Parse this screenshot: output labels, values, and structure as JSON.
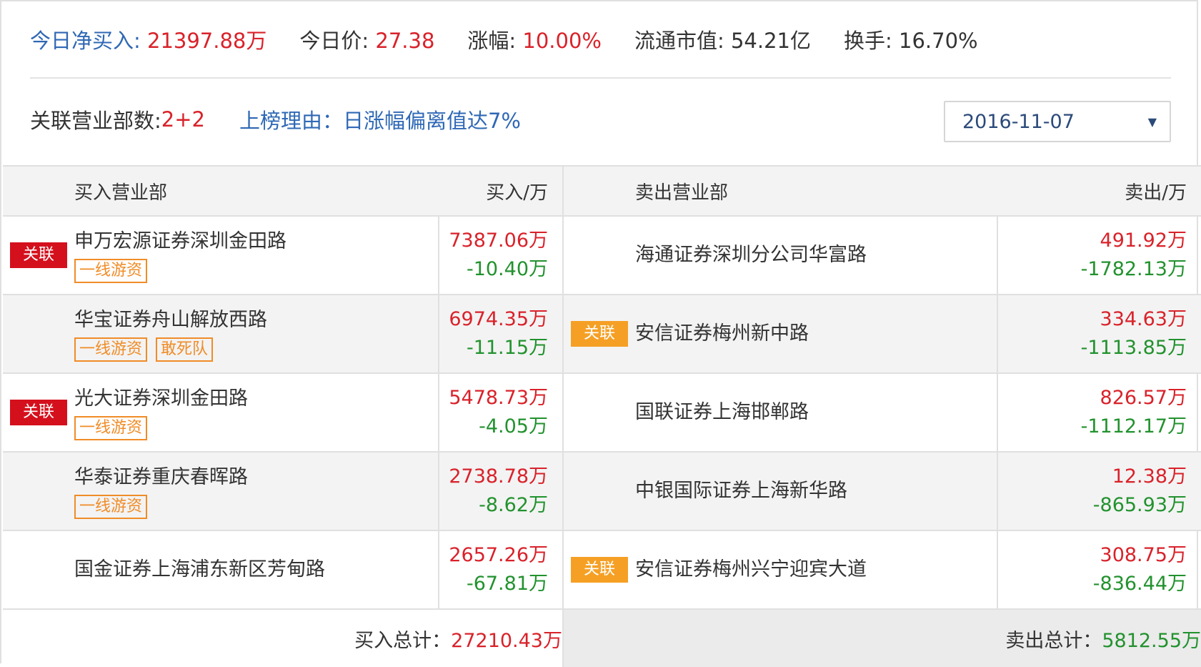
{
  "summary": {
    "net_buy_label": "今日净买入:",
    "net_buy_value": "21397.88万",
    "price_label": "今日价:",
    "price_value": "27.38",
    "change_label": "涨幅:",
    "change_value": "10.00%",
    "market_cap_label": "流通市值:",
    "market_cap_value": "54.21亿",
    "turnover_label": "换手:",
    "turnover_value": "16.70%"
  },
  "info": {
    "related_label": "关联营业部数:",
    "related_value": "2+2",
    "reason": "上榜理由：日涨幅偏离值达7%",
    "date": "2016-11-07",
    "dropdown_icon": "caret-down-icon"
  },
  "table": {
    "headers": {
      "buy_dept": "买入营业部",
      "buy_amount": "买入/万",
      "sell_dept": "卖出营业部",
      "sell_amount": "卖出/万"
    },
    "rows": [
      {
        "buy_badge": "关联",
        "buy_name": "申万宏源证券深圳金田路",
        "buy_tags": [
          "一线游资"
        ],
        "buy_amount": "7387.06万",
        "buy_sell_amount": "-10.40万",
        "sell_badge": "",
        "sell_name": "海通证券深圳分公司华富路",
        "sell_buy_amount": "491.92万",
        "sell_amount": "-1782.13万"
      },
      {
        "buy_badge": "",
        "buy_name": "华宝证券舟山解放西路",
        "buy_tags": [
          "一线游资",
          "敢死队"
        ],
        "buy_amount": "6974.35万",
        "buy_sell_amount": "-11.15万",
        "sell_badge": "关联",
        "sell_name": "安信证券梅州新中路",
        "sell_buy_amount": "334.63万",
        "sell_amount": "-1113.85万"
      },
      {
        "buy_badge": "关联",
        "buy_name": "光大证券深圳金田路",
        "buy_tags": [
          "一线游资"
        ],
        "buy_amount": "5478.73万",
        "buy_sell_amount": "-4.05万",
        "sell_badge": "",
        "sell_name": "国联证券上海邯郸路",
        "sell_buy_amount": "826.57万",
        "sell_amount": "-1112.17万"
      },
      {
        "buy_badge": "",
        "buy_name": "华泰证券重庆春晖路",
        "buy_tags": [
          "一线游资"
        ],
        "buy_amount": "2738.78万",
        "buy_sell_amount": "-8.62万",
        "sell_badge": "",
        "sell_name": "中银国际证券上海新华路",
        "sell_buy_amount": "12.38万",
        "sell_amount": "-865.93万"
      },
      {
        "buy_badge": "",
        "buy_name": "国金证券上海浦东新区芳甸路",
        "buy_tags": [],
        "buy_amount": "2657.26万",
        "buy_sell_amount": "-67.81万",
        "sell_badge": "关联",
        "sell_name": "安信证券梅州兴宁迎宾大道",
        "sell_buy_amount": "308.75万",
        "sell_amount": "-836.44万"
      }
    ],
    "footer": {
      "buy_total_label": "买入总计：",
      "buy_total_value": "27210.43万",
      "sell_total_label": "卖出总计：",
      "sell_total_value": "5812.55万"
    }
  },
  "colors": {
    "red": "#d9222a",
    "green": "#22922e",
    "blue": "#2f68b5",
    "orange": "#f08c27",
    "badge_red": "#d5101d",
    "badge_orange": "#f5a025"
  }
}
